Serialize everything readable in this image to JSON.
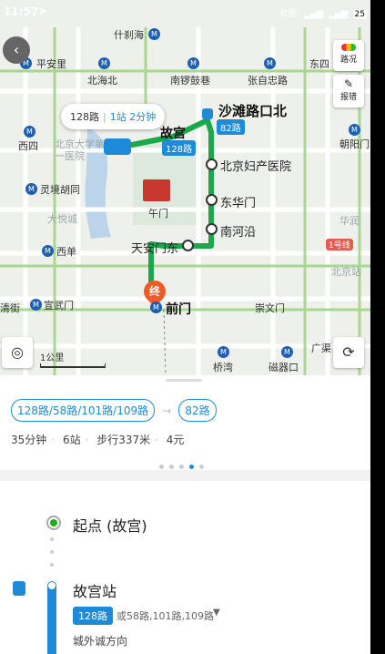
{
  "status": {
    "time": "11:57",
    "carrier": "北新",
    "battery": "25"
  },
  "map": {
    "places": {
      "shichahai": "什刹海",
      "pinganli": "平安里",
      "beihaibei": "北海北",
      "nanluoguxiang": "南锣鼓巷",
      "zhangzizhonglu": "张自忠路",
      "dongsi": "东四",
      "gugong": "故宫",
      "xisi": "西四",
      "pku_hospital": "北京大学第一医院",
      "shatan": "沙滩路口北",
      "chaoyangmen": "朝阳门",
      "fuchan": "北京妇产医院",
      "lingjing": "灵境胡同",
      "dongwumen": "午门",
      "donghuamen": "东华门",
      "dayuecheng": "大悦城",
      "nanheyan": "南河沿",
      "huarun": "华润",
      "xidan": "西单",
      "tiananmen_east": "天安门东",
      "line1": "1号线",
      "beijingzhan": "北京站",
      "qianmen": "前门",
      "xuanwumen": "宣武门",
      "chongwenmen": "崇文门",
      "qingjie": "清街",
      "guang": "广渠",
      "qiaowan": "桥湾",
      "ciqikou": "磁器口",
      "bus82": "82路",
      "bus128": "128路",
      "terminal": "终"
    },
    "callout": {
      "route": "128路",
      "detail": "1站 2分钟"
    },
    "scale": "1公里",
    "traffic_label": "路况",
    "report_label": "报错"
  },
  "panel": {
    "tags": [
      "128路/58路/101路/109路",
      "82路"
    ],
    "summary": {
      "duration": "35分钟",
      "stops": "6站",
      "walk": "步行337米",
      "price": "4元"
    },
    "steps": {
      "start": "起点 (故宫)",
      "station": "故宫站",
      "line": "128路",
      "alt": "或58路,101路,109路",
      "direction": "城外诚方向"
    }
  }
}
